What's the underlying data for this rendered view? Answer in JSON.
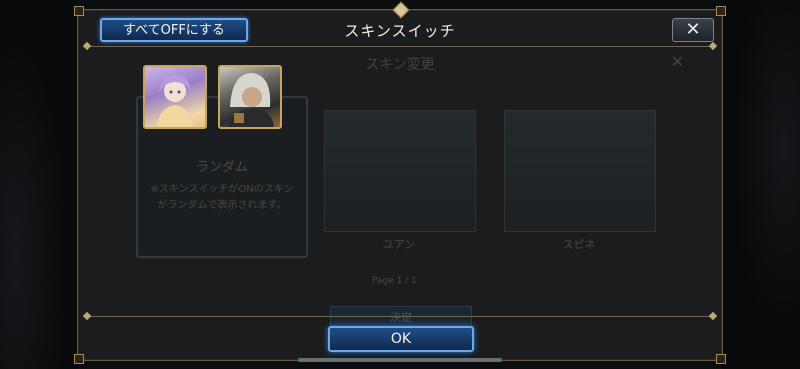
{
  "header": {
    "all_off_label": "すべてOFFにする",
    "title": "スキンスイッチ",
    "close_label": "✕"
  },
  "background_window": {
    "title": "スキン変更",
    "close_label": "✕",
    "random": {
      "name": "ランダム",
      "description": "※スキンスイッチがONのスキンがランダムで表示されます。"
    },
    "characters": [
      {
        "name": "ユアン"
      },
      {
        "name": "スピネ"
      }
    ],
    "page": "Page  1 / 1",
    "decide_label": "決定"
  },
  "skins": [
    {
      "icon": "character-portrait-lavender-hair",
      "selected": true
    },
    {
      "icon": "character-portrait-hooded",
      "selected": true
    }
  ],
  "footer": {
    "ok_label": "OK"
  },
  "colors": {
    "button_blue": "#1f4d86",
    "button_border": "#6fa8e8",
    "frame_gold": "#c8a55b"
  }
}
